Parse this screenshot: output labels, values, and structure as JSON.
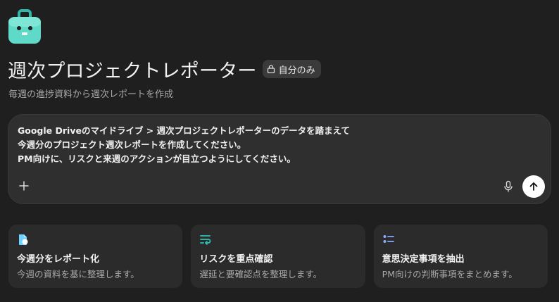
{
  "app": {
    "icon": "briefcase-robot-icon",
    "title": "週次プロジェクトレポーター",
    "visibility_badge": "自分のみ",
    "visibility_icon": "lock-icon",
    "subtitle": "毎週の進捗資料から週次レポートを作成"
  },
  "composer": {
    "prompt_lines": [
      "Google Driveのマイドライブ > 週次プロジェクトレポーターのデータを踏まえて",
      "今週分のプロジェクト週次レポートを作成してください。",
      "PM向けに、リスクと来週のアクションが目立つようにしてください。"
    ],
    "add_icon": "plus-icon",
    "mic_icon": "microphone-icon",
    "send_icon": "arrow-up-icon"
  },
  "suggestions": [
    {
      "icon": "document-icon",
      "title": "今週分をレポート化",
      "description": "今週の資料を基に整理します。"
    },
    {
      "icon": "wrap-lines-icon",
      "title": "リスクを重点確認",
      "description": "遅延と要確認点を整理します。"
    },
    {
      "icon": "list-icon",
      "title": "意思決定事項を抽出",
      "description": "PM向けの判断事項をまとめます。"
    }
  ],
  "colors": {
    "background": "#1f1f1f",
    "composer": "#2f2f2f",
    "card": "#2b2b2b",
    "accent_teal": "#34c3b6"
  }
}
